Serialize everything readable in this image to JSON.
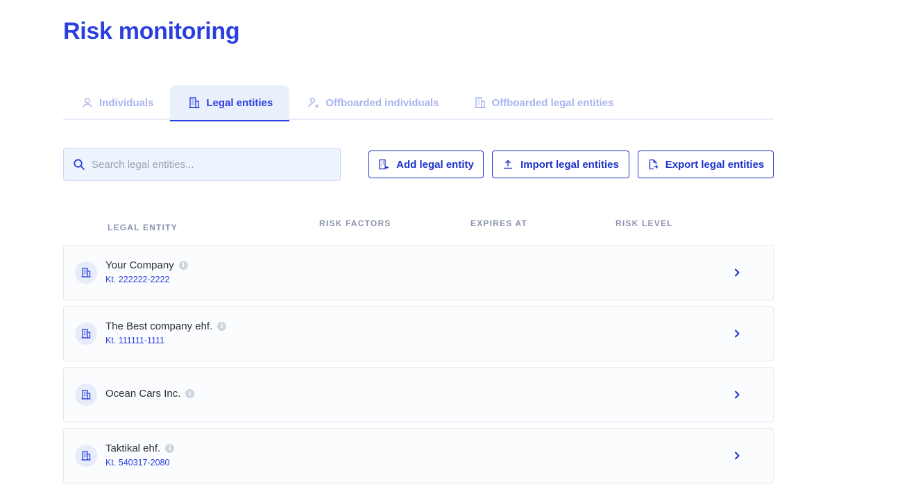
{
  "page": {
    "title": "Risk monitoring"
  },
  "tabs": [
    {
      "label": "Individuals",
      "icon": "user-icon",
      "active": false
    },
    {
      "label": "Legal entities",
      "icon": "building-icon",
      "active": true
    },
    {
      "label": "Offboarded individuals",
      "icon": "user-x-icon",
      "active": false
    },
    {
      "label": "Offboarded legal entities",
      "icon": "building-icon",
      "active": false
    }
  ],
  "search": {
    "placeholder": "Search legal entities...",
    "value": "",
    "icon": "search-icon"
  },
  "actions": {
    "add": {
      "label": "Add legal entity",
      "icon": "add-building-icon"
    },
    "import": {
      "label": "Import legal entities",
      "icon": "upload-icon"
    },
    "export": {
      "label": "Export legal entities",
      "icon": "export-file-icon"
    }
  },
  "table": {
    "columns": [
      "LEGAL ENTITY",
      "RISK FACTORS",
      "EXPIRES AT",
      "RISK LEVEL"
    ],
    "rows": [
      {
        "name": "Your Company",
        "id": "Kt. 222222-2222"
      },
      {
        "name": "The Best company ehf.",
        "id": "Kt. 111111-1111"
      },
      {
        "name": "Ocean Cars Inc.",
        "id": ""
      },
      {
        "name": "Taktikal ehf.",
        "id": "Kt. 540317-2080"
      }
    ]
  },
  "colors": {
    "accent": "#2b3ee0",
    "tab_inactive": "#a9b4ee",
    "row_bg": "#fbfcfe"
  }
}
